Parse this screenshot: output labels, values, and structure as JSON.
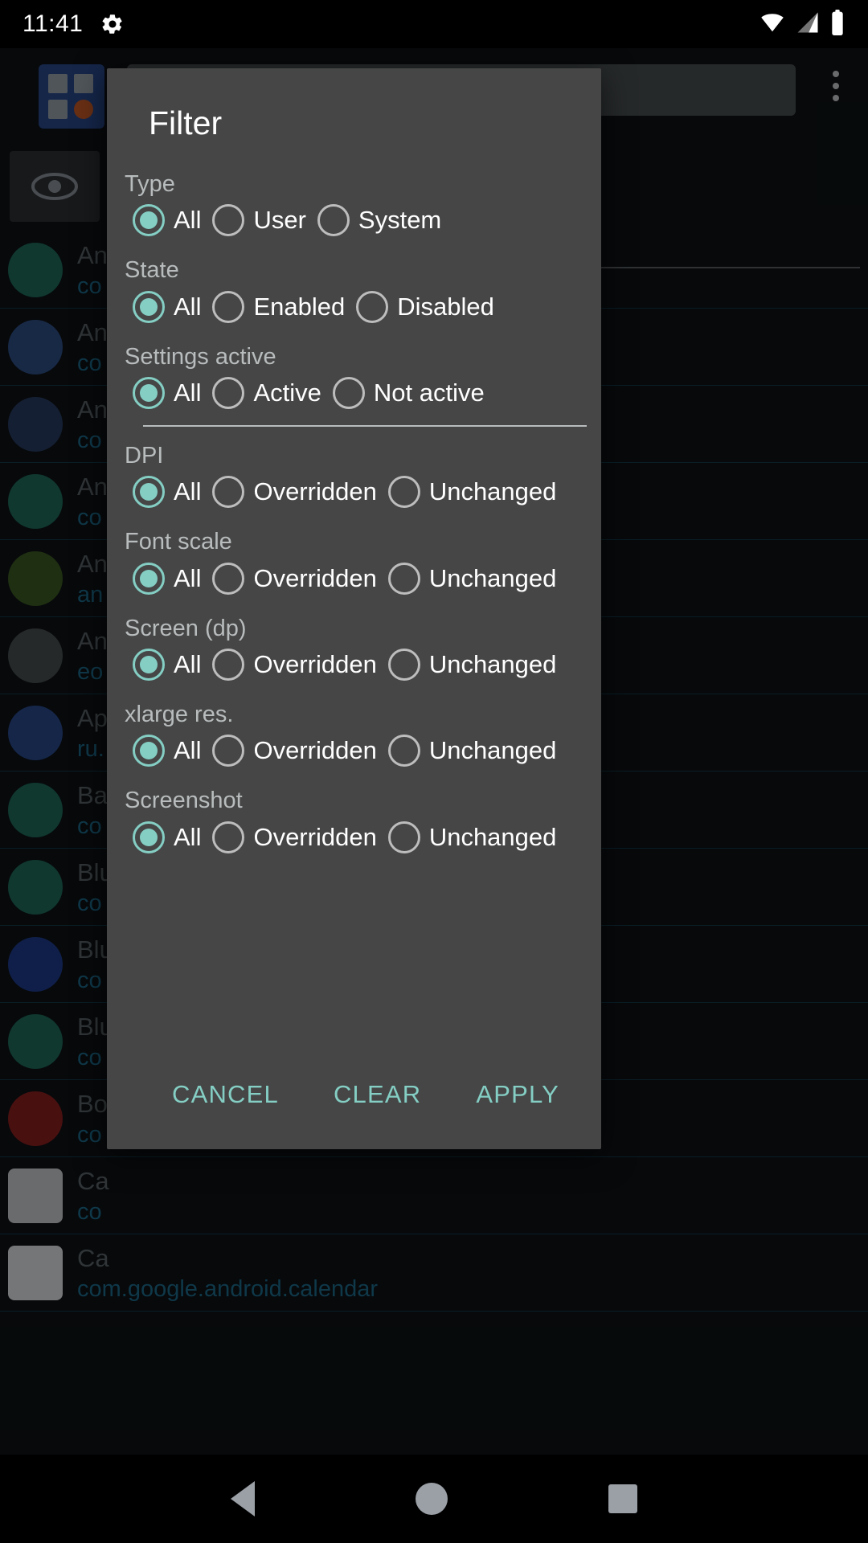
{
  "status_bar": {
    "clock": "11:41",
    "icons": [
      "gear-icon",
      "wifi-icon",
      "cell-signal-icon",
      "battery-icon"
    ]
  },
  "background_app": {
    "search_placeholder": "",
    "rows": [
      {
        "name": "An",
        "pkg": "co"
      },
      {
        "name": "An",
        "pkg": "co"
      },
      {
        "name": "An",
        "pkg": "co"
      },
      {
        "name": "An",
        "pkg": "co"
      },
      {
        "name": "An",
        "pkg": "an"
      },
      {
        "name": "An",
        "pkg": "eo"
      },
      {
        "name": "Ap",
        "pkg": "ru."
      },
      {
        "name": "Ba",
        "pkg": "co"
      },
      {
        "name": "Blu",
        "pkg": "co"
      },
      {
        "name": "Blu",
        "pkg": "co"
      },
      {
        "name": "Blu",
        "pkg": "co"
      },
      {
        "name": "Bo",
        "pkg": "co"
      },
      {
        "name": "Ca",
        "pkg": "co"
      },
      {
        "name": "Ca",
        "pkg": "com.google.android.calendar"
      }
    ]
  },
  "dialog": {
    "title": "Filter",
    "groups": [
      {
        "label": "Type",
        "options": [
          {
            "label": "All",
            "checked": true
          },
          {
            "label": "User",
            "checked": false
          },
          {
            "label": "System",
            "checked": false
          }
        ]
      },
      {
        "label": "State",
        "options": [
          {
            "label": "All",
            "checked": true
          },
          {
            "label": "Enabled",
            "checked": false
          },
          {
            "label": "Disabled",
            "checked": false
          }
        ]
      },
      {
        "label": "Settings active",
        "divider_after": true,
        "options": [
          {
            "label": "All",
            "checked": true
          },
          {
            "label": "Active",
            "checked": false
          },
          {
            "label": "Not active",
            "checked": false
          }
        ]
      },
      {
        "label": "DPI",
        "options": [
          {
            "label": "All",
            "checked": true
          },
          {
            "label": "Overridden",
            "checked": false
          },
          {
            "label": "Unchanged",
            "checked": false
          }
        ]
      },
      {
        "label": "Font scale",
        "options": [
          {
            "label": "All",
            "checked": true
          },
          {
            "label": "Overridden",
            "checked": false
          },
          {
            "label": "Unchanged",
            "checked": false
          }
        ]
      },
      {
        "label": "Screen (dp)",
        "options": [
          {
            "label": "All",
            "checked": true
          },
          {
            "label": "Overridden",
            "checked": false
          },
          {
            "label": "Unchanged",
            "checked": false
          }
        ]
      },
      {
        "label": "xlarge res.",
        "options": [
          {
            "label": "All",
            "checked": true
          },
          {
            "label": "Overridden",
            "checked": false
          },
          {
            "label": "Unchanged",
            "checked": false
          }
        ]
      },
      {
        "label": "Screenshot",
        "options": [
          {
            "label": "All",
            "checked": true
          },
          {
            "label": "Overridden",
            "checked": false
          },
          {
            "label": "Unchanged",
            "checked": false
          }
        ]
      }
    ],
    "actions": [
      {
        "label": "CANCEL",
        "name": "cancel-button"
      },
      {
        "label": "CLEAR",
        "name": "clear-button"
      },
      {
        "label": "APPLY",
        "name": "apply-button"
      }
    ]
  },
  "nav_bar": {
    "items": [
      "back-icon",
      "home-icon",
      "recents-icon"
    ]
  },
  "colors": {
    "accent": "#84cec4",
    "dialog_bg": "#464646",
    "label": "#b8bcbd",
    "text": "#ffffff"
  }
}
